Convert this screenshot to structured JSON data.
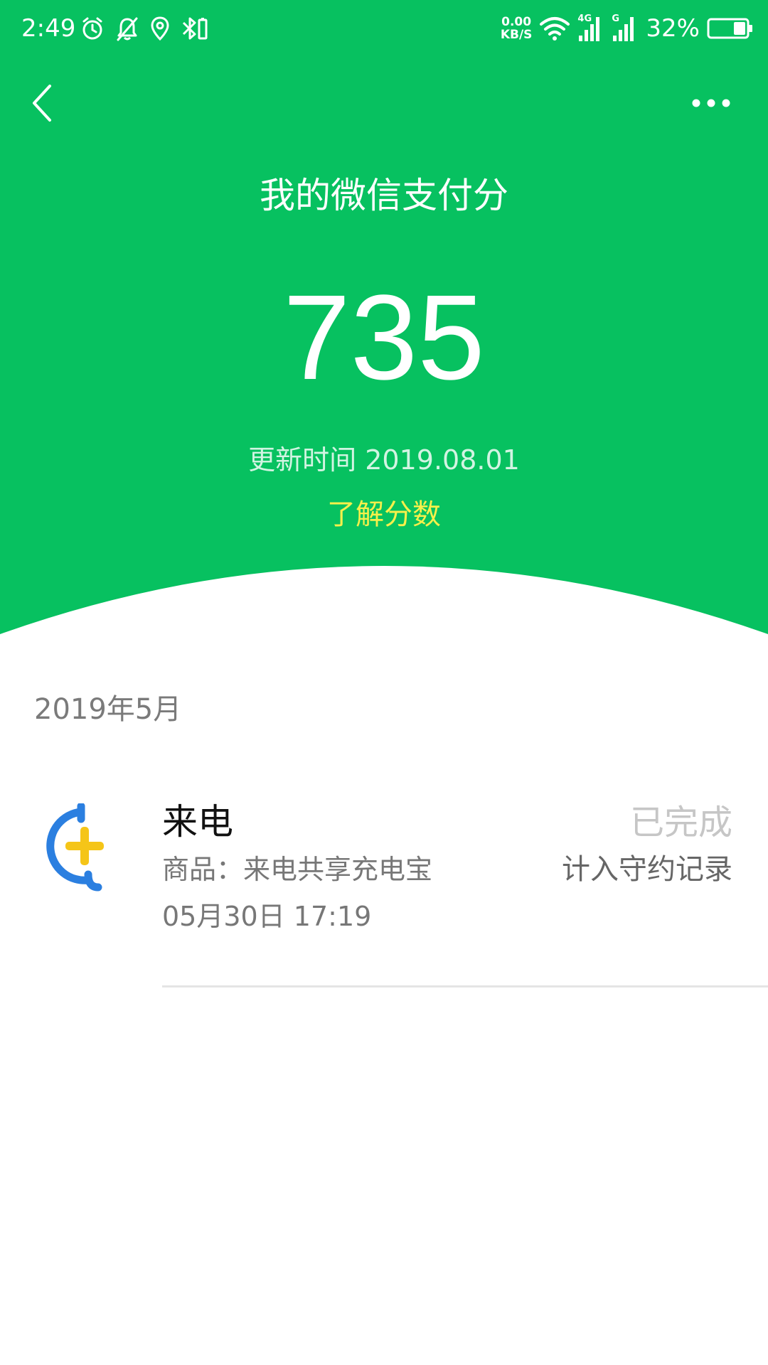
{
  "status_bar": {
    "time": "2:49",
    "net_speed_value": "0.00",
    "net_speed_unit": "KB/S",
    "network_label_1": "4G",
    "network_label_2": "G",
    "battery_percent": "32%",
    "battery_level": 0.32
  },
  "nav": {
    "back_icon": "chevron-left-icon",
    "more_icon": "more-dots-icon"
  },
  "header": {
    "title": "我的微信支付分",
    "score": "735",
    "update_time": "更新时间 2019.08.01",
    "learn_link": "了解分数"
  },
  "records": {
    "month": "2019年5月",
    "items": [
      {
        "name": "来电",
        "goods": "商品：来电共享充电宝",
        "time": "05月30日 17:19",
        "status": "已完成",
        "note": "计入守约记录",
        "logo_icon": "laidian-logo-icon"
      }
    ]
  },
  "colors": {
    "brand_green": "#07C160",
    "link_yellow": "#F6F04A",
    "logo_blue": "#2B7FE0",
    "logo_yellow": "#F5C518"
  }
}
